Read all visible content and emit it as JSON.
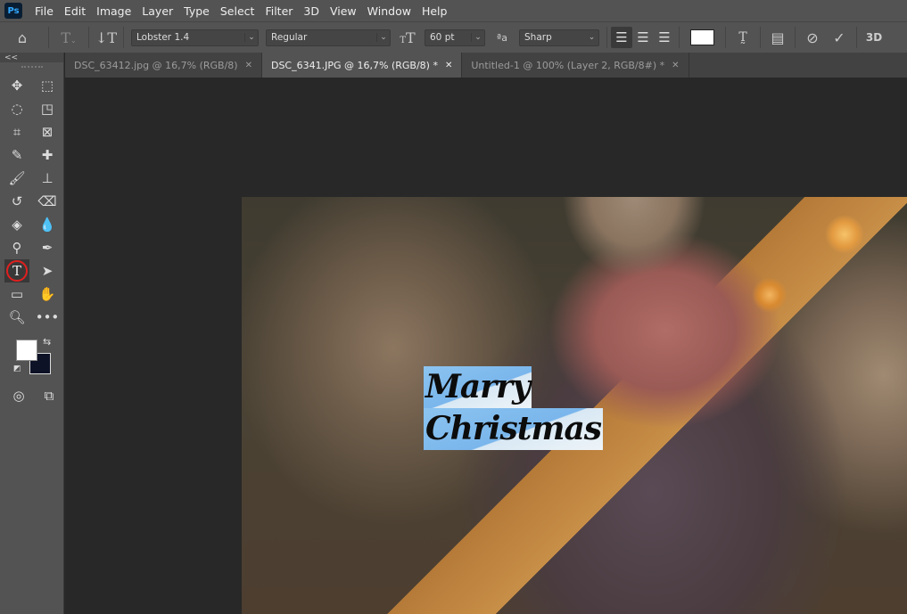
{
  "app": {
    "logo": "Ps"
  },
  "menu": [
    "File",
    "Edit",
    "Image",
    "Layer",
    "Type",
    "Select",
    "Filter",
    "3D",
    "View",
    "Window",
    "Help"
  ],
  "options": {
    "font_family": "Lobster 1.4",
    "font_style": "Regular",
    "font_size": "60 pt",
    "antialias": "Sharp",
    "text_color": "#ffffff",
    "threed_label": "3D"
  },
  "tabs": [
    {
      "label": "DSC_63412.jpg @ 16,7% (RGB/8)",
      "active": false
    },
    {
      "label": "DSC_6341.JPG @ 16,7% (RGB/8) *",
      "active": true
    },
    {
      "label": "Untitled-1 @ 100% (Layer 2, RGB/8#) *",
      "active": false
    }
  ],
  "toolbar": {
    "collapse": "<<",
    "foreground": "#ffffff",
    "background": "#0d1226",
    "active_tool": "type-tool"
  },
  "canvas": {
    "text_lines": [
      "Marry",
      "Christmas"
    ]
  }
}
